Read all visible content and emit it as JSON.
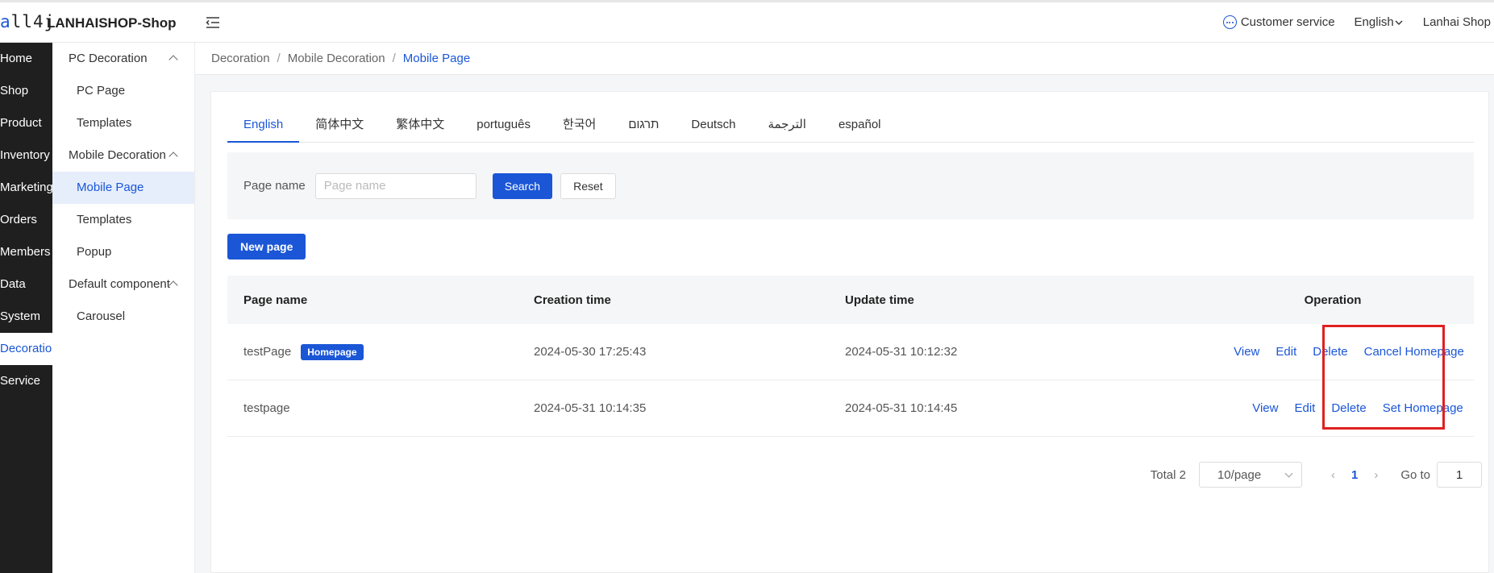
{
  "header": {
    "logo": "all4j",
    "app_name": "LANHAISHOP-Shop",
    "customer_service": "Customer service",
    "language": "English",
    "shop_name": "Lanhai Shop"
  },
  "main_nav": [
    "Home",
    "Shop",
    "Product",
    "Inventory",
    "Marketing",
    "Orders",
    "Members",
    "Data",
    "System",
    "Decoration",
    "Service"
  ],
  "sub_nav": {
    "pc_group": "PC Decoration",
    "pc_page": "PC Page",
    "pc_templates": "Templates",
    "mobile_group": "Mobile Decoration",
    "mobile_page": "Mobile Page",
    "mobile_templates": "Templates",
    "popup": "Popup",
    "default_group": "Default component",
    "carousel": "Carousel"
  },
  "breadcrumb": {
    "level1": "Decoration",
    "level2": "Mobile Decoration",
    "current": "Mobile Page"
  },
  "tabs": [
    "English",
    "简体中文",
    "繁体中文",
    "português",
    "한국어",
    "תרגום",
    "Deutsch",
    "الترجمة",
    "español"
  ],
  "filter": {
    "label": "Page name",
    "placeholder": "Page name",
    "search": "Search",
    "reset": "Reset"
  },
  "new_page": "New page",
  "table": {
    "headers": {
      "name": "Page name",
      "created": "Creation time",
      "updated": "Update time",
      "operation": "Operation"
    },
    "rows": [
      {
        "name": "testPage",
        "badge": "Homepage",
        "created": "2024-05-30 17:25:43",
        "updated": "2024-05-31 10:12:32",
        "view": "View",
        "edit": "Edit",
        "delete": "Delete",
        "homepage_action": "Cancel Homepage"
      },
      {
        "name": "testpage",
        "created": "2024-05-31 10:14:35",
        "updated": "2024-05-31 10:14:45",
        "view": "View",
        "edit": "Edit",
        "delete": "Delete",
        "homepage_action": "Set Homepage"
      }
    ]
  },
  "pagination": {
    "total": "Total 2",
    "page_size": "10/page",
    "prev": "‹",
    "current_page": "1",
    "next": "›",
    "goto_label": "Go to",
    "goto_value": "1"
  },
  "colors": {
    "accent": "#1a56d6",
    "sidebar_dark": "#1f1f1f",
    "highlight": "#e0201f"
  }
}
